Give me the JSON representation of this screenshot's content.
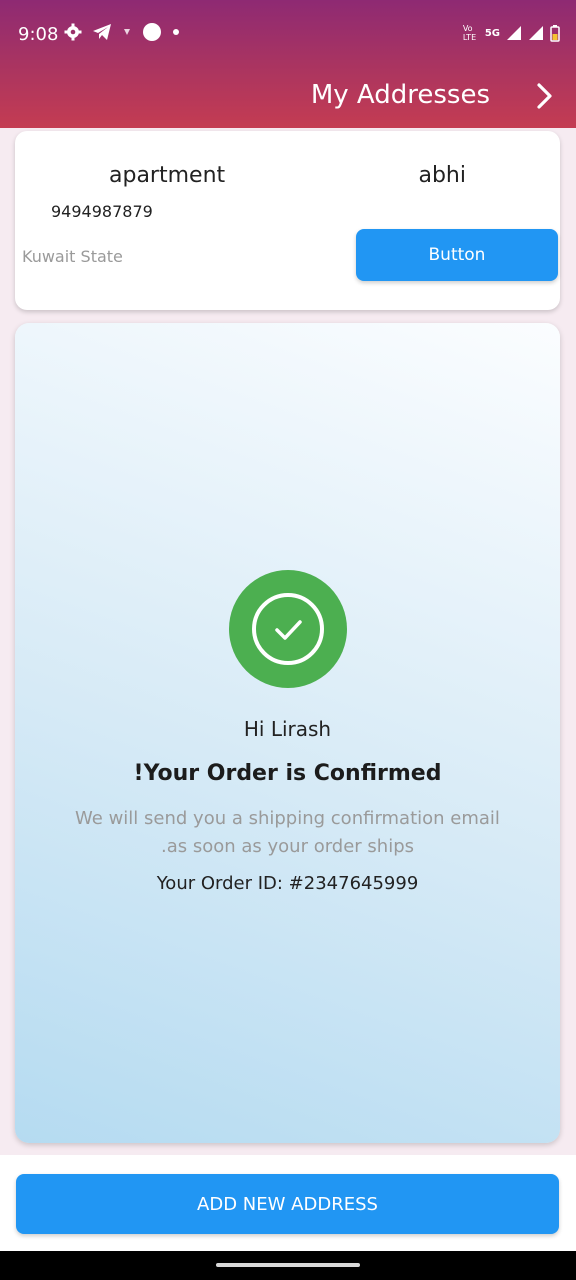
{
  "status_bar": {
    "time": "9:08",
    "network_label": "5G",
    "carrier_label": "Vo LTE",
    "icons": [
      "gear-icon",
      "telegram-icon",
      "signal-small-icon",
      "dot-icon",
      "dot-small-icon",
      "wifi-signal-icon",
      "cell-signal-icon",
      "battery-icon"
    ]
  },
  "app_bar": {
    "title": "My Addresses",
    "forward_icon": "chevron-right-icon"
  },
  "address_card": {
    "type": "apartment",
    "name": "abhi",
    "phone": "9494987879",
    "state": "Kuwait State",
    "button_label": "Button"
  },
  "confirmation": {
    "icon": "check-circle-icon",
    "greeting": "Hi Lirash",
    "title": "!Your Order is Confirmed",
    "message_line1": "We will send you a shipping confirmation email",
    "message_line2": ".as soon as your order ships",
    "order_id": "Your Order ID: #2347645999"
  },
  "footer": {
    "add_button_label": "ADD NEW ADDRESS"
  },
  "colors": {
    "primary_blue": "#2196f3",
    "success_green": "#4caf50",
    "appbar_top": "#8e2a73",
    "appbar_bottom": "#c43c52"
  }
}
